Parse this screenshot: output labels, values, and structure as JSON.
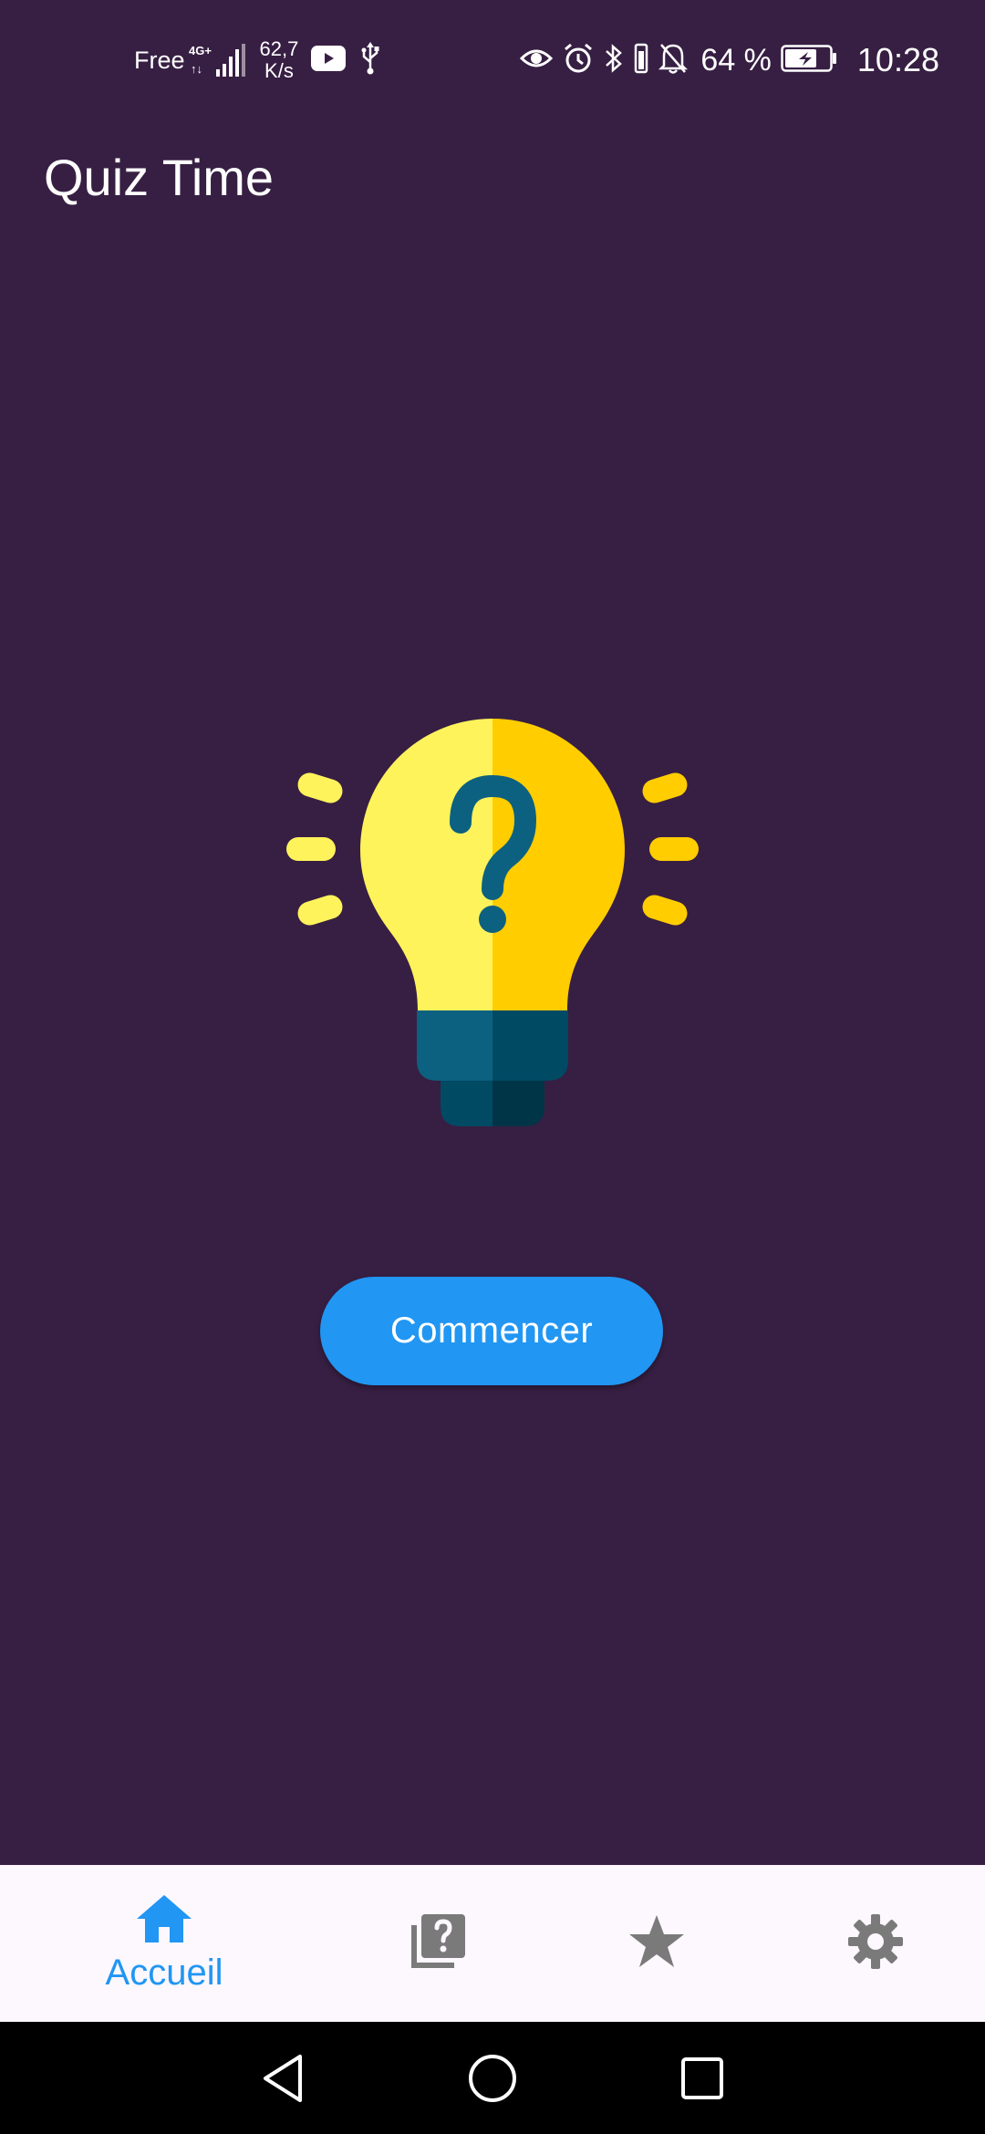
{
  "status_bar": {
    "carrier": "Free",
    "network_type": "4G+",
    "speed_value": "62,7",
    "speed_unit": "K/s",
    "battery_percent": "64 %",
    "time": "10:28",
    "icons": [
      "signal-icon",
      "youtube-icon",
      "usb-icon",
      "eye-icon",
      "alarm-icon",
      "bluetooth-icon",
      "vibrate-icon",
      "mute-icon",
      "battery-icon"
    ]
  },
  "app": {
    "title": "Quiz Time"
  },
  "main": {
    "start_label": "Commencer",
    "hero_icon": "lightbulb-question-icon"
  },
  "bottom_nav": {
    "items": [
      {
        "label": "Accueil",
        "icon": "home-icon",
        "active": true
      },
      {
        "label": "",
        "icon": "quiz-icon",
        "active": false
      },
      {
        "label": "",
        "icon": "star-icon",
        "active": false
      },
      {
        "label": "",
        "icon": "gear-icon",
        "active": false
      }
    ]
  },
  "colors": {
    "background": "#371f43",
    "accent": "#2196f3",
    "nav_background": "#fdf7fe",
    "inactive_icon": "#7a7a7a",
    "bulb_light": "#fff35c",
    "bulb_dark": "#ffcd00",
    "bulb_base": "#005066"
  }
}
